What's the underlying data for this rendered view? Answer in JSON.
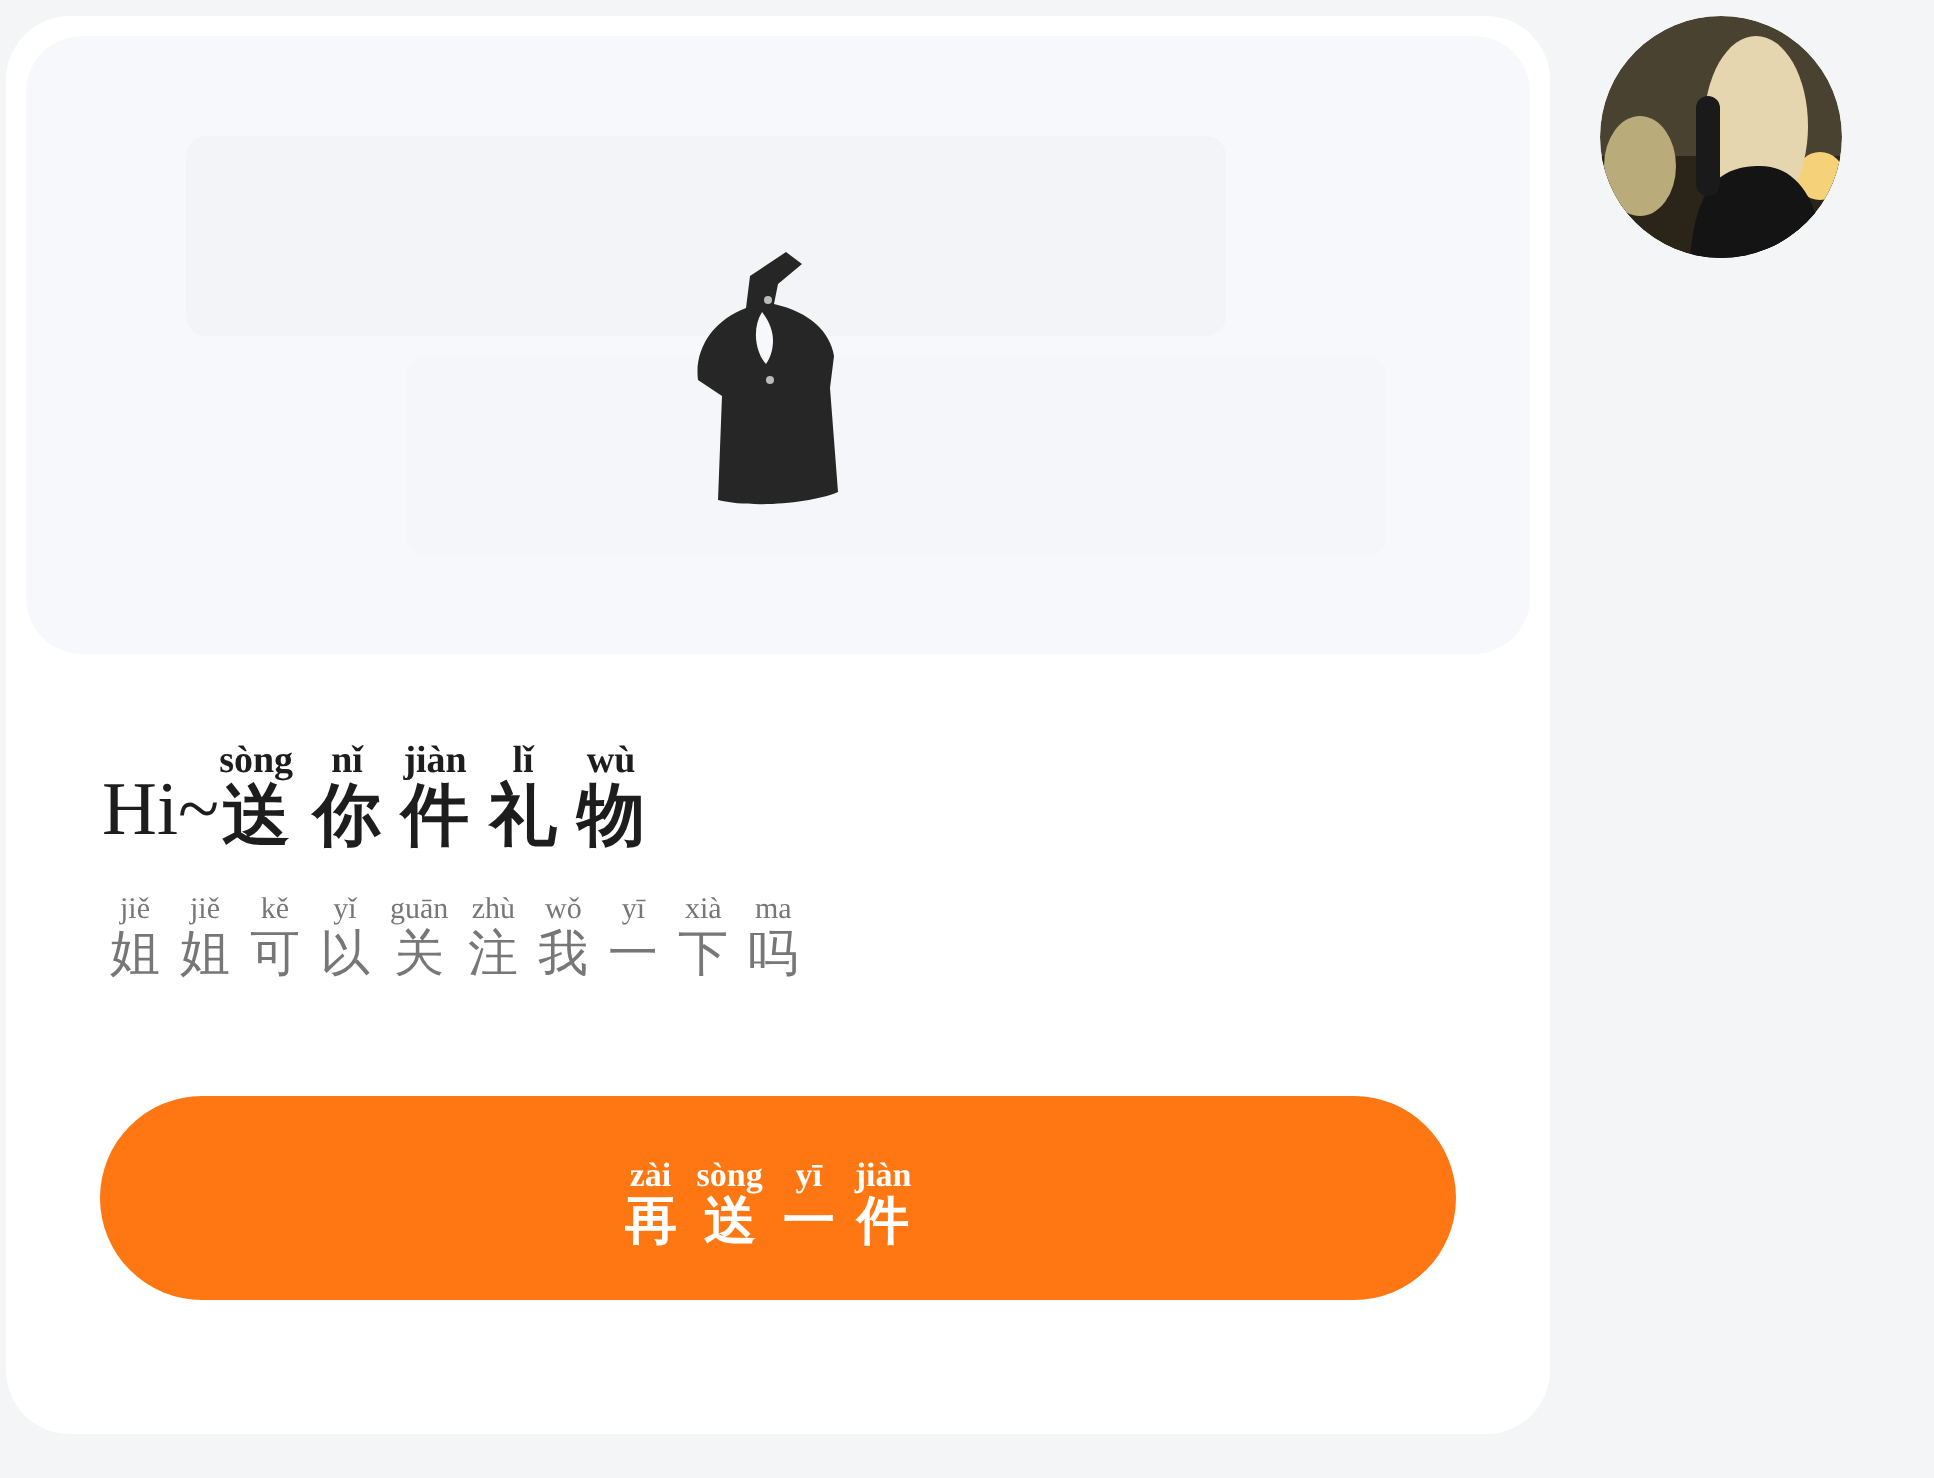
{
  "title": {
    "prefix": "Hi~",
    "chars": [
      {
        "hanzi": "送",
        "pinyin": "sòng"
      },
      {
        "hanzi": "你",
        "pinyin": "nǐ"
      },
      {
        "hanzi": "件",
        "pinyin": "jiàn"
      },
      {
        "hanzi": "礼",
        "pinyin": "lǐ"
      },
      {
        "hanzi": "物",
        "pinyin": "wù"
      }
    ]
  },
  "subtitle": {
    "chars": [
      {
        "hanzi": "姐",
        "pinyin": "jiě"
      },
      {
        "hanzi": "姐",
        "pinyin": "jiě"
      },
      {
        "hanzi": "可",
        "pinyin": "kě"
      },
      {
        "hanzi": "以",
        "pinyin": "yǐ"
      },
      {
        "hanzi": "关",
        "pinyin": "guān"
      },
      {
        "hanzi": "注",
        "pinyin": "zhù"
      },
      {
        "hanzi": "我",
        "pinyin": "wǒ"
      },
      {
        "hanzi": "一",
        "pinyin": "yī"
      },
      {
        "hanzi": "下",
        "pinyin": "xià"
      },
      {
        "hanzi": "吗",
        "pinyin": "ma"
      }
    ]
  },
  "button": {
    "chars": [
      {
        "hanzi": "再",
        "pinyin": "zài"
      },
      {
        "hanzi": "送",
        "pinyin": "sòng"
      },
      {
        "hanzi": "一",
        "pinyin": "yī"
      },
      {
        "hanzi": "件",
        "pinyin": "jiàn"
      }
    ]
  }
}
